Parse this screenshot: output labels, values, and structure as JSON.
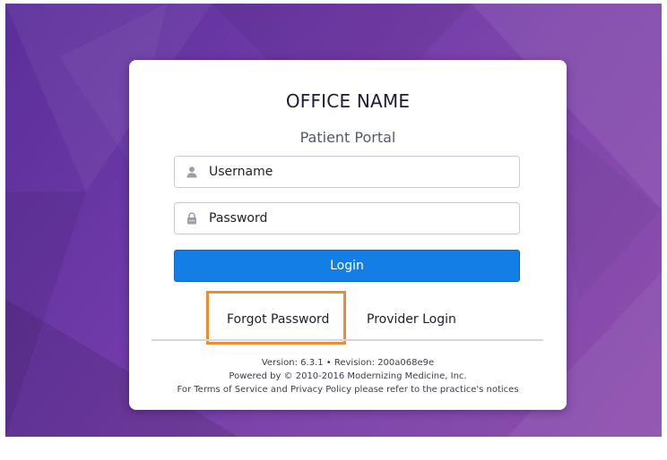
{
  "office": {
    "name": "OFFICE NAME",
    "portal_label": "Patient Portal"
  },
  "form": {
    "username_placeholder": "Username",
    "password_placeholder": "Password",
    "login_label": "Login"
  },
  "links": {
    "forgot_password": "Forgot Password",
    "provider_login": "Provider Login"
  },
  "footer": {
    "version": "Version: 6.3.1 • Revision: 200a068e9e",
    "powered_by": "Powered by © 2010-2016 Modernizing Medicine, Inc.",
    "terms": "For Terms of Service and Privacy Policy please refer to the practice's notices"
  },
  "icons": {
    "username": "user-icon",
    "password": "lock-icon"
  },
  "colors": {
    "background": "#6f3aa8",
    "primary_button": "#137fe6",
    "highlight": "#f08a2c"
  }
}
